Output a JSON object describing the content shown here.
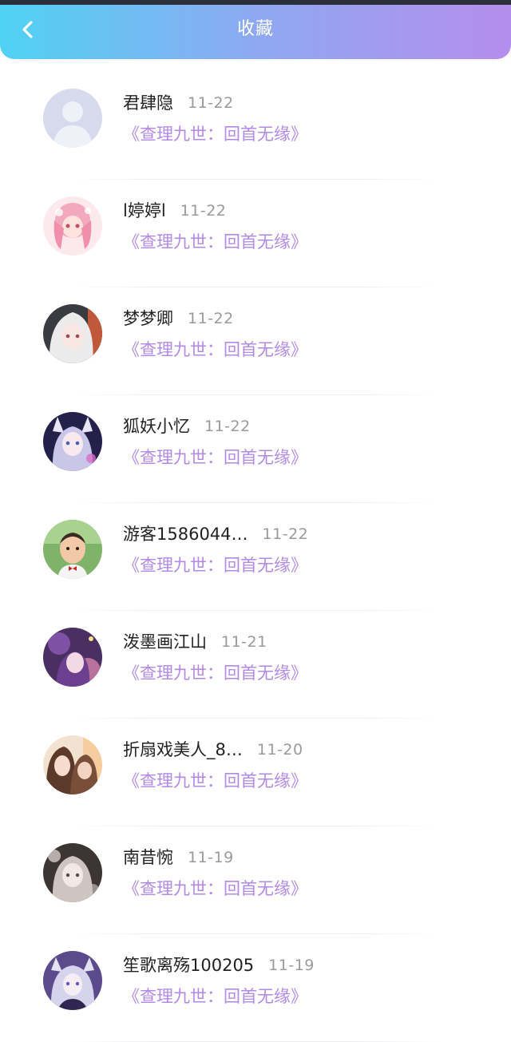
{
  "header": {
    "title": "收藏",
    "back_icon": "chevron-left-icon"
  },
  "colors": {
    "header_gradient_start": "#4fd2f4",
    "header_gradient_end": "#b58ded",
    "work_title": "#b28ae6",
    "date": "#9a9a9a",
    "name": "#222222"
  },
  "items": [
    {
      "name": "君肆隐",
      "date": "11-22",
      "work": "《查理九世：回首无缘》",
      "avatar": "default-user-avatar"
    },
    {
      "name": "l婷婷l",
      "date": "11-22",
      "work": "《查理九世：回首无缘》",
      "avatar": "pink-anime-girl-avatar"
    },
    {
      "name": "梦梦卿",
      "date": "11-22",
      "work": "《查理九世：回首无缘》",
      "avatar": "white-hair-girl-avatar"
    },
    {
      "name": "狐妖小忆",
      "date": "11-22",
      "work": "《查理九世：回首无缘》",
      "avatar": "fox-girl-avatar"
    },
    {
      "name": "游客1586044…",
      "date": "11-22",
      "work": "《查理九世：回首无缘》",
      "avatar": "child-photo-avatar"
    },
    {
      "name": "泼墨画江山",
      "date": "11-21",
      "work": "《查理九世：回首无缘》",
      "avatar": "purple-anime-avatar"
    },
    {
      "name": "折扇戏美人_8…",
      "date": "11-20",
      "work": "《查理九世：回首无缘》",
      "avatar": "anime-couple-avatar"
    },
    {
      "name": "南昔惋",
      "date": "11-19",
      "work": "《查理九世：回首无缘》",
      "avatar": "sketch-girl-avatar"
    },
    {
      "name": "笙歌离殇100205",
      "date": "11-19",
      "work": "《查理九世：回首无缘》",
      "avatar": "silver-hair-boy-avatar"
    }
  ]
}
